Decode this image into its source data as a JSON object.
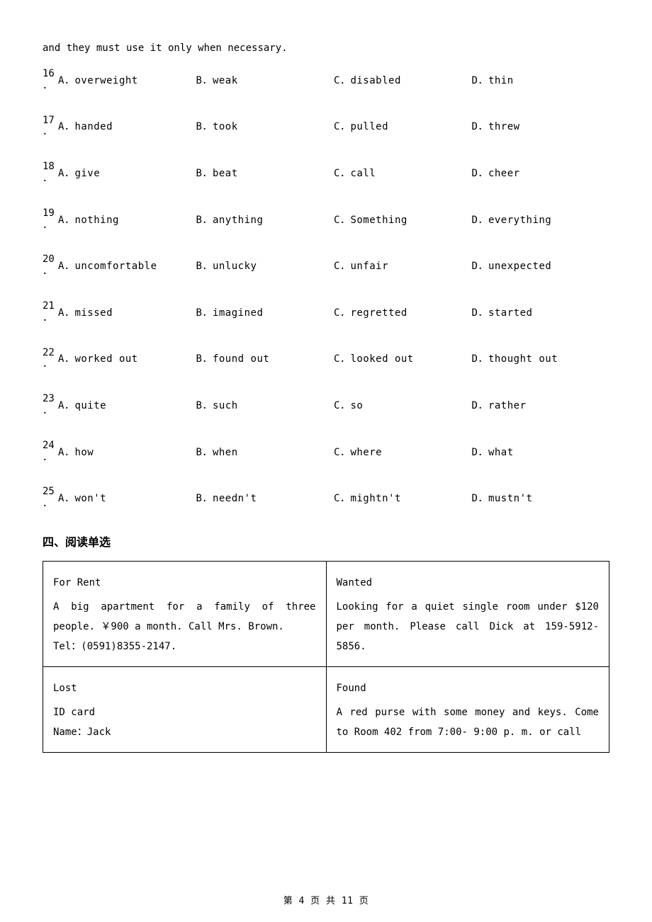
{
  "intro": "and they must use it only when necessary.",
  "questions": [
    {
      "num": "16",
      "opts": [
        {
          "l": "A．",
          "t": "overweight"
        },
        {
          "l": "B．",
          "t": "weak"
        },
        {
          "l": "C．",
          "t": "disabled"
        },
        {
          "l": "D．",
          "t": "thin"
        }
      ]
    },
    {
      "num": "17",
      "opts": [
        {
          "l": "A．",
          "t": "handed"
        },
        {
          "l": "B．",
          "t": "took"
        },
        {
          "l": "C．",
          "t": "pulled"
        },
        {
          "l": "D．",
          "t": "threw"
        }
      ]
    },
    {
      "num": "18",
      "opts": [
        {
          "l": "A．",
          "t": "give"
        },
        {
          "l": "B．",
          "t": "beat"
        },
        {
          "l": "C．",
          "t": "call"
        },
        {
          "l": "D．",
          "t": "cheer"
        }
      ]
    },
    {
      "num": "19",
      "opts": [
        {
          "l": "A．",
          "t": "nothing"
        },
        {
          "l": "B．",
          "t": "anything"
        },
        {
          "l": "C．",
          "t": "Something"
        },
        {
          "l": "D．",
          "t": "everything"
        }
      ]
    },
    {
      "num": "20",
      "opts": [
        {
          "l": "A．",
          "t": "uncomfortable"
        },
        {
          "l": "B．",
          "t": "unlucky"
        },
        {
          "l": "C．",
          "t": "unfair"
        },
        {
          "l": "D．",
          "t": "unexpected"
        }
      ]
    },
    {
      "num": "21",
      "opts": [
        {
          "l": "A．",
          "t": "missed"
        },
        {
          "l": "B．",
          "t": "imagined"
        },
        {
          "l": "C．",
          "t": "regretted"
        },
        {
          "l": "D．",
          "t": "started"
        }
      ]
    },
    {
      "num": "22",
      "opts": [
        {
          "l": "A．",
          "t": "worked out"
        },
        {
          "l": "B．",
          "t": "found  out"
        },
        {
          "l": "C．",
          "t": "looked out"
        },
        {
          "l": "D．",
          "t": "thought out"
        }
      ]
    },
    {
      "num": "23",
      "opts": [
        {
          "l": "A．",
          "t": "quite"
        },
        {
          "l": "B．",
          "t": "such"
        },
        {
          "l": "C．",
          "t": "so"
        },
        {
          "l": "D．",
          "t": "rather"
        }
      ]
    },
    {
      "num": "24",
      "opts": [
        {
          "l": "A．",
          "t": "how"
        },
        {
          "l": "B．",
          "t": "when"
        },
        {
          "l": "C．",
          "t": "where"
        },
        {
          "l": "D．",
          "t": "what"
        }
      ]
    },
    {
      "num": "25",
      "opts": [
        {
          "l": "A．",
          "t": "won't"
        },
        {
          "l": "B．",
          "t": "needn't"
        },
        {
          "l": "C．",
          "t": "mightn't"
        },
        {
          "l": "D．",
          "t": "mustn't"
        }
      ]
    }
  ],
  "section_head": "四、阅读单选",
  "ads": {
    "row1": {
      "left": {
        "title": "For Rent",
        "body": "A big apartment for a family of three people. ￥900 a month. Call Mrs. Brown.",
        "tel": "Tel：(0591)8355-2147."
      },
      "right": {
        "title": "Wanted",
        "body": "Looking for a quiet single room under $120 per month. Please call Dick at 159-5912-5856."
      }
    },
    "row2": {
      "left": {
        "title": "Lost",
        "line1": "ID card",
        "line2": "Name：Jack"
      },
      "right": {
        "title": "Found",
        "body": "A red purse with some money and keys. Come to Room 402 from 7:00- 9:00 p. m. or call"
      }
    }
  },
  "footer": "第 4 页 共 11 页"
}
